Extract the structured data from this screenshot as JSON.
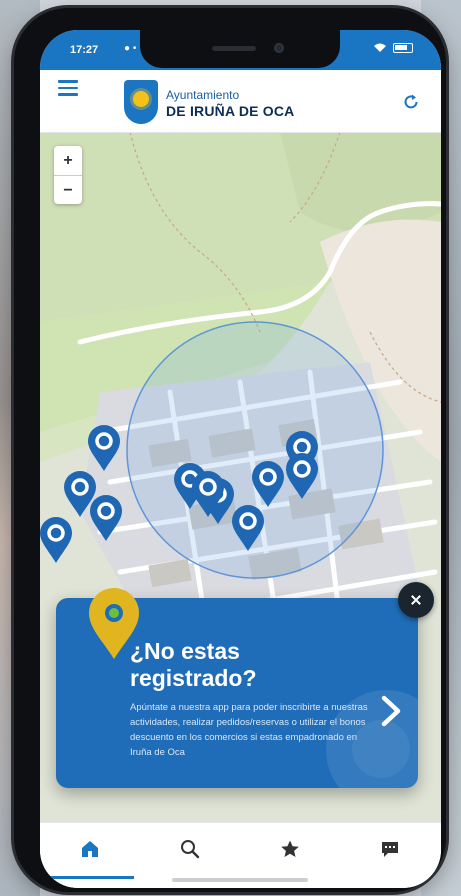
{
  "status_bar": {
    "time": "17:27",
    "tray": "● •"
  },
  "header": {
    "logo_line1": "Ayuntamiento",
    "logo_line2": "DE IRUÑA DE OCA"
  },
  "map": {
    "zoom_in": "+",
    "zoom_out": "−",
    "marker_count": 11
  },
  "promo_card": {
    "title_line1": "¿No estas",
    "title_line2": "registrado?",
    "body": "Apúntate a nuestra app para poder inscribirte a nuestras actividades, realizar pedidos/reservas o utilizar el bonos descuento en los comercios si estas empadronado en Iruña de Oca"
  },
  "tabs": [
    {
      "icon": "home-icon",
      "active": true
    },
    {
      "icon": "search-icon",
      "active": false
    },
    {
      "icon": "star-icon",
      "active": false
    },
    {
      "icon": "chat-icon",
      "active": false
    }
  ],
  "colors": {
    "brand_blue": "#1a75c2",
    "card_blue": "#1f6db8",
    "accent_yellow": "#f2c21b",
    "marker_blue": "#1f67b3"
  }
}
